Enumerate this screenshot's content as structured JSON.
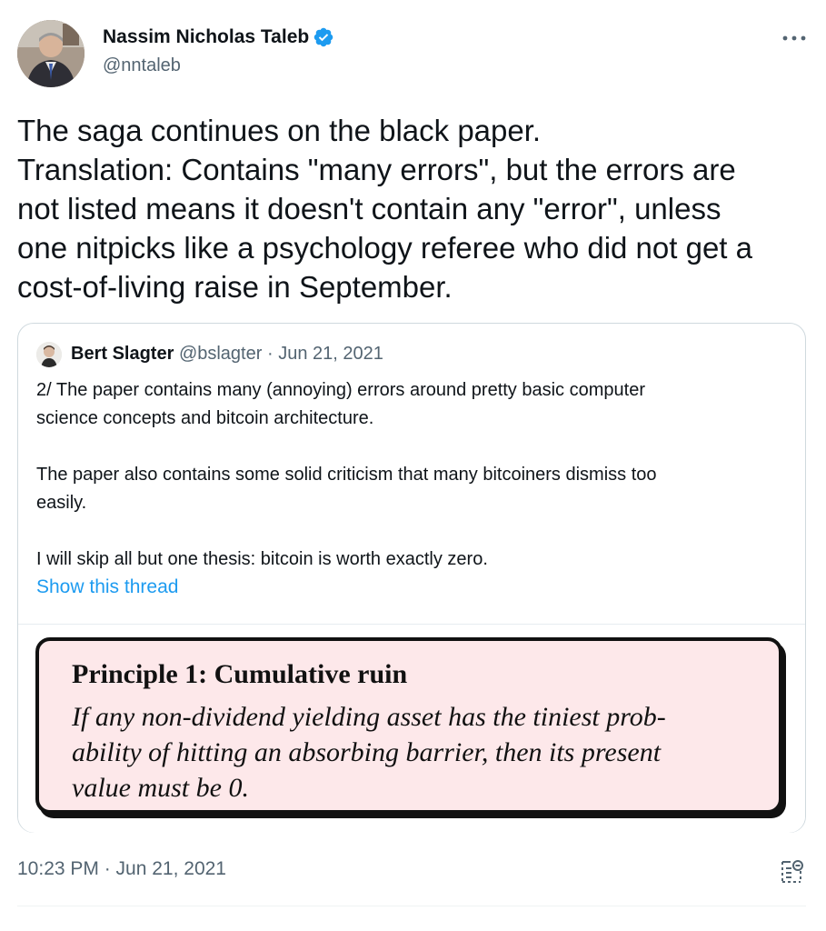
{
  "author": {
    "name": "Nassim Nicholas Taleb",
    "handle": "@nntaleb",
    "verified": true
  },
  "tweet": {
    "text_lines": [
      "The saga continues on the black paper.",
      "Translation: Contains \"many errors\", but the errors are",
      "not listed means it doesn't contain any \"error\", unless",
      "one nitpicks like a psychology referee who did not get a",
      "cost-of-living raise in September."
    ]
  },
  "quote": {
    "name": "Bert Slagter",
    "handle": "@bslagter",
    "separator": "·",
    "date": "Jun 21, 2021",
    "text_lines": [
      "2/ The paper contains many (annoying) errors around pretty basic computer",
      "science concepts and bitcoin architecture.",
      "",
      "The paper also contains some solid criticism that many bitcoiners dismiss too",
      "easily.",
      "",
      "I will skip all but one thesis: bitcoin is worth exactly zero."
    ],
    "show_thread": "Show this thread",
    "image": {
      "title": "Principle 1: Cumulative ruin",
      "body_lines": [
        "If any non-dividend yielding asset has the tiniest prob-",
        "ability of hitting an absorbing barrier, then its present",
        "value must be 0."
      ]
    }
  },
  "footer": {
    "timestamp": "10:23 PM · Jun 21, 2021"
  },
  "colors": {
    "accent": "#1d9bf0",
    "secondary_text": "#536471",
    "border": "#cfd9de",
    "principle_bg": "#fde8ea"
  },
  "icons": {
    "verified": "verified-badge-icon",
    "more": "more-options-icon",
    "analytics": "view-analytics-icon"
  }
}
